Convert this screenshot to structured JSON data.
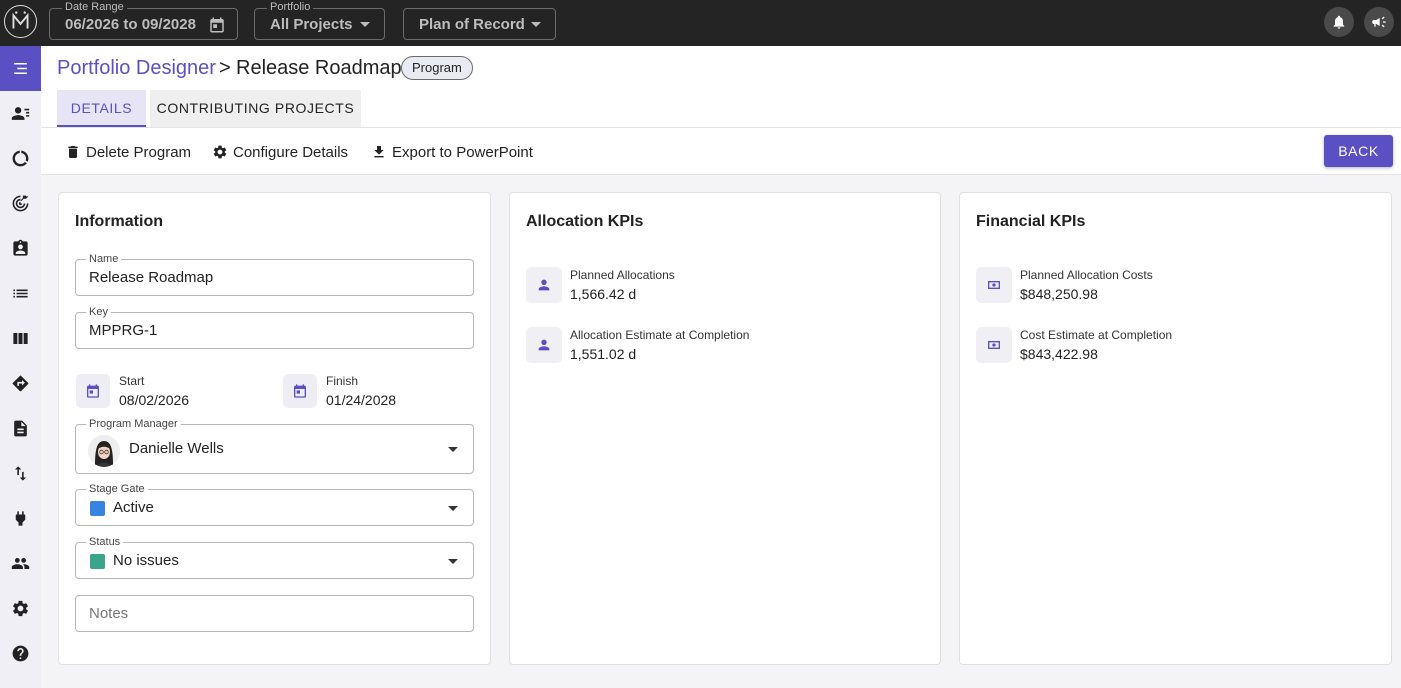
{
  "topbar": {
    "date_range": {
      "label": "Date Range",
      "value": "06/2026 to 09/2028"
    },
    "portfolio": {
      "label": "Portfolio",
      "value": "All Projects"
    },
    "plan": {
      "value": "Plan of Record"
    }
  },
  "sidebar": {
    "icons": [
      "menu-collapse-icon",
      "users-list-icon",
      "donut-chart-icon",
      "target-icon",
      "badge-icon",
      "list-icon",
      "columns-icon",
      "directions-icon",
      "document-icon",
      "swap-vertical-icon",
      "plug-icon",
      "people-icon",
      "gear-icon",
      "help-icon"
    ],
    "active_index": 0
  },
  "breadcrumb": {
    "parent": "Portfolio Designer",
    "separator": ">",
    "current": "Release Roadmap",
    "chip": "Program"
  },
  "tabs": [
    {
      "label": "DETAILS",
      "active": true
    },
    {
      "label": "CONTRIBUTING PROJECTS",
      "active": false
    }
  ],
  "actions": {
    "delete": "Delete Program",
    "configure": "Configure Details",
    "export": "Export to PowerPoint",
    "back": "BACK"
  },
  "information": {
    "title": "Information",
    "name": {
      "label": "Name",
      "value": "Release Roadmap"
    },
    "key": {
      "label": "Key",
      "value": "MPPRG-1"
    },
    "start": {
      "label": "Start",
      "value": "08/02/2026"
    },
    "finish": {
      "label": "Finish",
      "value": "01/24/2028"
    },
    "program_manager": {
      "label": "Program Manager",
      "value": "Danielle Wells"
    },
    "stage_gate": {
      "label": "Stage Gate",
      "value": "Active",
      "color": "#3584e4"
    },
    "status": {
      "label": "Status",
      "value": "No issues",
      "color": "#3aa58a"
    },
    "notes": {
      "placeholder": "Notes"
    }
  },
  "allocation_kpis": {
    "title": "Allocation KPIs",
    "items": [
      {
        "label": "Planned Allocations",
        "value": "1,566.42 d"
      },
      {
        "label": "Allocation Estimate at Completion",
        "value": "1,551.02 d"
      }
    ]
  },
  "financial_kpis": {
    "title": "Financial KPIs",
    "items": [
      {
        "label": "Planned Allocation Costs",
        "value": "$848,250.98"
      },
      {
        "label": "Cost Estimate at Completion",
        "value": "$843,422.98"
      }
    ]
  },
  "colors": {
    "accent": "#5b4fc4",
    "topbar": "#242424"
  }
}
